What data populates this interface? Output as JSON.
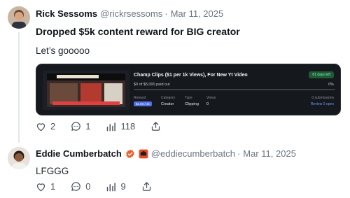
{
  "post1": {
    "author_name": "Rick Sessoms",
    "handle": "@rickrsessoms",
    "separator": "·",
    "date": "Mar 11, 2025",
    "title": "Dropped $5k content reward for BIG creator",
    "body": "Let’s gooooo",
    "card": {
      "campaign_title": "Champ Clips ($1 per 1k Views), For New Yt Video",
      "days_left": "61 days left",
      "paid_out": "$0 of $5,000 paid out",
      "percent": "0%",
      "progress_fraction": 0,
      "reward_label": "Reward",
      "reward_value": "$1.00 / 1k",
      "category_label": "Category",
      "category_value": "Creator",
      "type_label": "Type",
      "type_value": "Clipping",
      "views_label": "Views",
      "views_value": "0",
      "submissions": "0 submissions",
      "review": "Review 0 open"
    },
    "actions": {
      "likes": "2",
      "comments": "1",
      "views": "118"
    }
  },
  "post2": {
    "author_name": "Eddie Cumberbatch",
    "handle": "@eddiecumberbatch",
    "separator": "·",
    "date": "Mar 11, 2025",
    "body": "LFGGG",
    "actions": {
      "likes": "1",
      "comments": "0",
      "views": "9"
    }
  },
  "colors": {
    "accent": "#4f86ff",
    "verified": "#e8612c",
    "muted": "#6b7580"
  },
  "icons": [
    "heart-icon",
    "comment-icon",
    "views-icon",
    "share-icon",
    "verified-icon",
    "affiliate-badge-icon"
  ]
}
